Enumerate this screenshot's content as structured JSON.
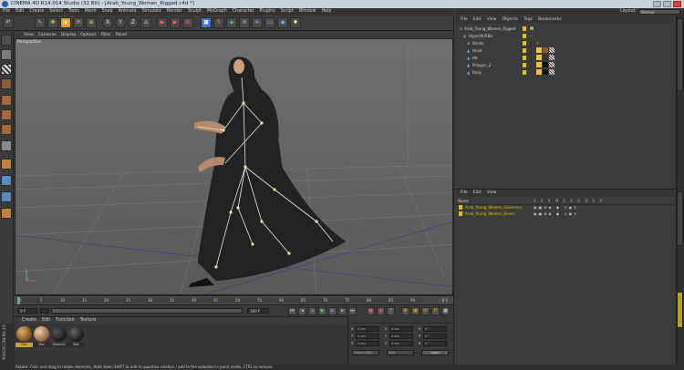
{
  "window": {
    "title": "CINEMA 4D R14.014 Studio (32 Bit) - [Arab_Young_Women_Rigged.c4d *]"
  },
  "menubar": [
    "File",
    "Edit",
    "Create",
    "Select",
    "Tools",
    "Mesh",
    "Snap",
    "Animate",
    "Simulate",
    "Render",
    "Sculpt",
    "MoGraph",
    "Character",
    "Plugins",
    "Script",
    "Window",
    "Help"
  ],
  "objects_menu": [
    "File",
    "Edit",
    "View",
    "Objects",
    "Tags",
    "Bookmarks"
  ],
  "layout": {
    "label": "Layout:",
    "value": "Startup"
  },
  "viewport": {
    "menu": [
      "View",
      "Cameras",
      "Display",
      "Options",
      "Filter",
      "Panel"
    ],
    "label": "Perspective"
  },
  "objects": [
    {
      "name": "Arab_Young_Women_Rigged",
      "indent": 0
    },
    {
      "name": "HyperNURBS",
      "indent": 1
    },
    {
      "name": "Bones",
      "indent": 2
    },
    {
      "name": "Head",
      "indent": 2
    },
    {
      "name": "Hit",
      "indent": 2
    },
    {
      "name": "Polygon_2",
      "indent": 2
    },
    {
      "name": "Body",
      "indent": 2
    }
  ],
  "layers_menu": [
    "File",
    "Edit",
    "View"
  ],
  "layers": {
    "header": "Name",
    "items": [
      "Arab_Young_Women_Geometry",
      "Arab_Young_Women_Bones"
    ]
  },
  "timeline": {
    "ticks": [
      "0",
      "5",
      "10",
      "15",
      "20",
      "25",
      "30",
      "35",
      "40",
      "45",
      "50",
      "55",
      "60",
      "65",
      "70",
      "75",
      "80",
      "85",
      "90"
    ],
    "end_label": "0 F"
  },
  "playback": {
    "current_frame": "0 F",
    "start_frame": "0 F",
    "end_frame": "100 F",
    "max_frame": "90 F"
  },
  "material_manager": {
    "menu": [
      "Create",
      "Edit",
      "Function",
      "Texture"
    ],
    "materials": [
      "Mat",
      "Mat",
      "Material",
      "Mat"
    ]
  },
  "coordinates": {
    "rows": [
      [
        "X",
        "0 cm",
        "X",
        "0 cm",
        "H",
        "0 °"
      ],
      [
        "Y",
        "0 cm",
        "Y",
        "0 cm",
        "P",
        "0 °"
      ],
      [
        "Z",
        "0 cm",
        "Z",
        "0 cm",
        "B",
        "0 °"
      ]
    ],
    "mode_a": "Object (Rel)",
    "mode_b": "Size",
    "apply": "Apply"
  },
  "status": "Rotate: Click and drag to rotate elements. Hold down SHIFT to add to quantize rotation / add to the selection in point mode, CTRL to remove.",
  "brand": "MAXON CINEMA 4D",
  "colors": {
    "accent": "#e0c000",
    "viewport_top": "#6f6f6f",
    "panel": "#3b3b3b"
  }
}
